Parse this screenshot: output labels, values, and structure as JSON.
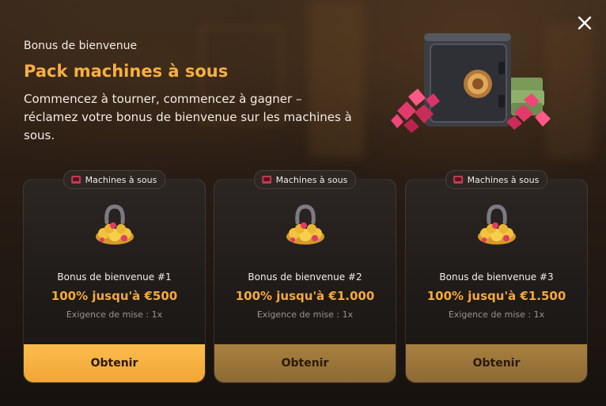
{
  "header": {
    "subtitle": "Bonus de bienvenue",
    "title": "Pack machines à sous",
    "description": "Commencez à tourner, commencez à gagner – réclamez votre bonus de bienvenue sur les machines à sous."
  },
  "colors": {
    "accent": "#f6b041",
    "button_primary": "#f9b446",
    "button_muted": "#9c7639"
  },
  "cards": [
    {
      "tag": "Machines à sous",
      "tag_icon": "slot-machine-icon",
      "name": "Bonus de bienvenue #1",
      "amount": "100% jusqu'à €500",
      "requirement": "Exigence de mise : 1x",
      "button": "Obtenir",
      "active": true
    },
    {
      "tag": "Machines à sous",
      "tag_icon": "slot-machine-icon",
      "name": "Bonus de bienvenue #2",
      "amount": "100% jusqu'à €1.000",
      "requirement": "Exigence de mise : 1x",
      "button": "Obtenir",
      "active": false
    },
    {
      "tag": "Machines à sous",
      "tag_icon": "slot-machine-icon",
      "name": "Bonus de bienvenue #3",
      "amount": "100% jusqu'à €1.500",
      "requirement": "Exigence de mise : 1x",
      "button": "Obtenir",
      "active": false
    }
  ],
  "icons": {
    "close": "close-icon",
    "hero": "safe-with-gems-illustration",
    "card_art": "horseshoe-gold-coins-icon"
  }
}
